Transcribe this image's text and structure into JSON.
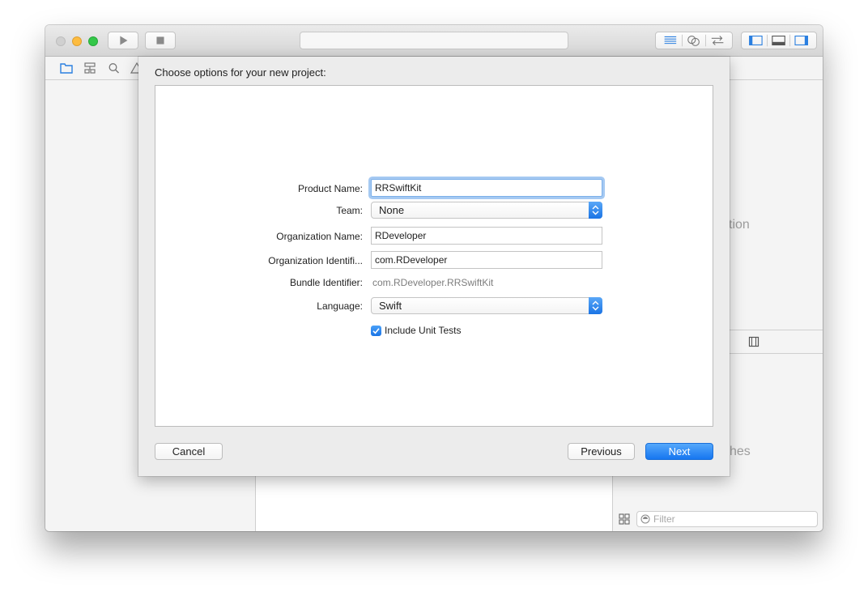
{
  "sheet": {
    "title": "Choose options for your new project:",
    "form": {
      "product_name": {
        "label": "Product Name:",
        "value": "RRSwiftKit"
      },
      "team": {
        "label": "Team:",
        "value": "None"
      },
      "organization_name": {
        "label": "Organization Name:",
        "value": "RDeveloper"
      },
      "organization_identifier": {
        "label": "Organization Identifi...",
        "value": "com.RDeveloper"
      },
      "bundle_identifier": {
        "label": "Bundle Identifier:",
        "value": "com.RDeveloper.RRSwiftKit"
      },
      "language": {
        "label": "Language:",
        "value": "Swift"
      },
      "include_unit_tests": {
        "label": "Include Unit Tests",
        "checked": true
      }
    },
    "buttons": {
      "cancel": "Cancel",
      "previous": "Previous",
      "next": "Next"
    }
  },
  "background": {
    "upper_right_fragment": "ction",
    "lower_right_fragment": "ches",
    "filter_placeholder": "Filter"
  },
  "icons": {
    "run": "play-icon",
    "stop": "stop-icon",
    "editor_standard": "lines-icon",
    "editor_assistant": "venn-icon",
    "editor_version": "arrows-icon",
    "toggle_navigator": "left-panel-icon",
    "toggle_debug": "bottom-panel-icon",
    "toggle_utilities": "right-panel-icon"
  },
  "colors": {
    "accent": "#1a74e5",
    "focus_ring": "#5b9ce8"
  }
}
